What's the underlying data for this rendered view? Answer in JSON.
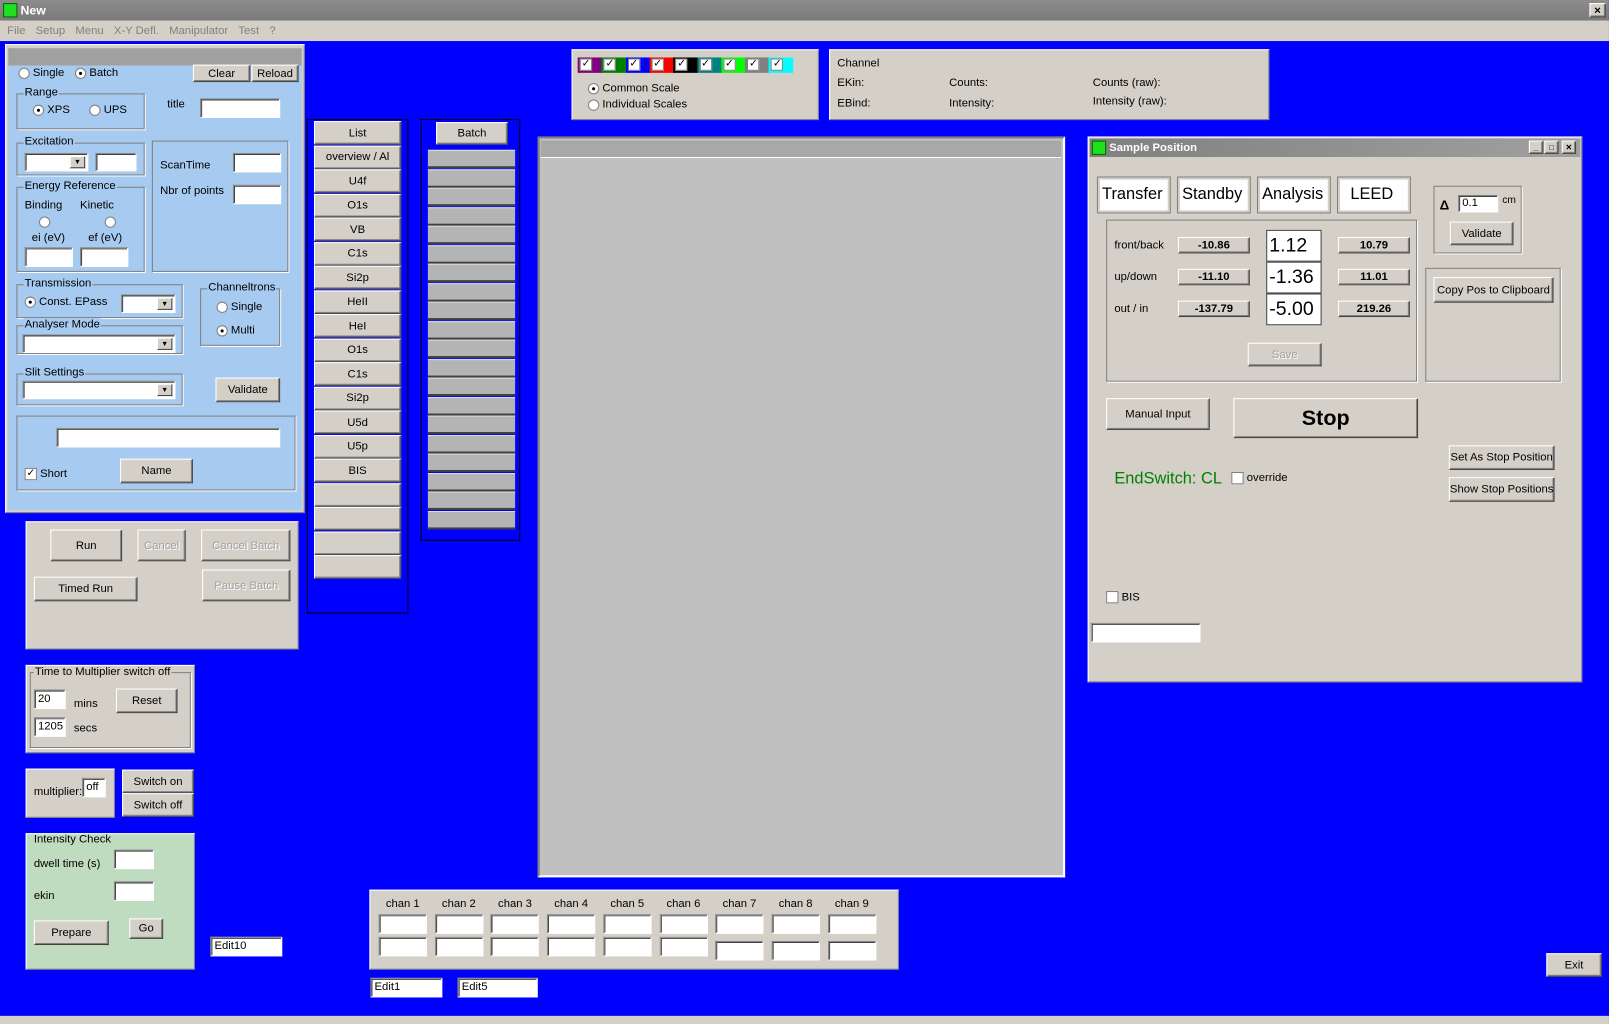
{
  "window": {
    "title": "New",
    "close": "✕"
  },
  "menu": [
    "File",
    "Setup",
    "Menu",
    "X-Y Defl.",
    "Manipulator",
    "Test",
    "?"
  ],
  "acq": {
    "single": "Single",
    "batch": "Batch",
    "clear": "Clear",
    "reload": "Reload",
    "range": "Range",
    "xps": "XPS",
    "ups": "UPS",
    "title_label": "title",
    "title_value": "",
    "excitation": "Excitation",
    "scantime": "ScanTime",
    "nbr_points": "Nbr of points",
    "energy_ref": "Energy Reference",
    "binding": "Binding",
    "kinetic": "Kinetic",
    "ei": "ei (eV)",
    "ef": "ef (eV)",
    "transmission": "Transmission",
    "const_epass": "Const. EPass",
    "channeltrons": "Channeltrons",
    "ch_single": "Single",
    "ch_multi": "Multi",
    "analyser_mode": "Analyser Mode",
    "slit_settings": "Slit Settings",
    "validate": "Validate",
    "short": "Short",
    "name": "Name"
  },
  "run": {
    "run": "Run",
    "cancel": "Cancel",
    "cancel_batch": "Cancel Batch",
    "timed_run": "Timed Run",
    "pause_batch": "Pause Batch"
  },
  "multiplier_timer": {
    "title": "Time to Multiplier switch off",
    "mins_value": "20",
    "mins": "mins",
    "reset": "Reset",
    "secs_value": "1205",
    "secs": "secs"
  },
  "multiplier": {
    "label": "multiplier:",
    "value": "off",
    "switch_on": "Switch on",
    "switch_off": "Switch off"
  },
  "intensity": {
    "title": "Intensity Check",
    "dwell": "dwell time (s)",
    "ekin": "ekin",
    "prepare": "Prepare",
    "go": "Go"
  },
  "edit10": "Edit10",
  "edit1": "Edit1",
  "edit5": "Edit5",
  "list": [
    "List",
    "overview / Al",
    "U4f",
    "O1s",
    "VB",
    "C1s",
    "Si2p",
    "HeII",
    "HeI",
    "O1s",
    "C1s",
    "Si2p",
    "U5d",
    "U5p",
    "BIS",
    "",
    "",
    "",
    ""
  ],
  "batch": {
    "label": "Batch",
    "slots": 20
  },
  "channels_colors": [
    "#800080",
    "#008000",
    "#0000ff",
    "#ff0000",
    "#000000",
    "#008080",
    "#00ff00",
    "#808080",
    "#00ffff"
  ],
  "scale": {
    "common": "Common Scale",
    "individual": "Individual Scales"
  },
  "readout": {
    "channel": "Channel",
    "ekin": "EKin:",
    "ebind": "EBind:",
    "counts": "Counts:",
    "intensity": "Intensity:",
    "counts_raw": "Counts (raw):",
    "intensity_raw": "Intensity (raw):"
  },
  "chans": [
    "chan 1",
    "chan 2",
    "chan 3",
    "chan 4",
    "chan 5",
    "chan 6",
    "chan 7",
    "chan 8",
    "chan 9"
  ],
  "sample": {
    "title": "Sample Position",
    "presets": [
      "Transfer",
      "Standby",
      "Analysis",
      "LEED"
    ],
    "rows": [
      {
        "label": "front/back",
        "min": "-10.86",
        "cur": "1.12",
        "max": "10.79"
      },
      {
        "label": "up/down",
        "min": "-11.10",
        "cur": "-1.36",
        "max": "11.01"
      },
      {
        "label": "out / in",
        "min": "-137.79",
        "cur": "-5.00",
        "max": "219.26"
      }
    ],
    "save": "Save",
    "delta": "Δ",
    "delta_value": "0.1",
    "cm": "cm",
    "validate": "Validate",
    "copy": "Copy Pos to Clipboard",
    "manual": "Manual Input",
    "stop": "Stop",
    "set_stop": "Set As Stop Position",
    "show_stop": "Show Stop Positions",
    "endswitch": "EndSwitch: CL",
    "override": "override",
    "bis": "BIS"
  },
  "exit": "Exit"
}
